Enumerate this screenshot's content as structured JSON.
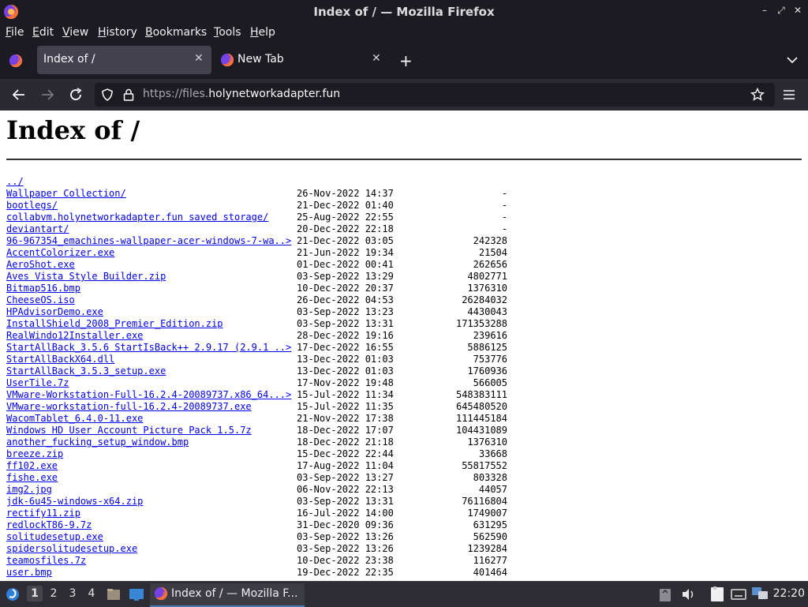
{
  "window": {
    "title": "Index of / — Mozilla Firefox"
  },
  "menubar": {
    "items": [
      {
        "label": "File",
        "accel": "F",
        "rest": "ile"
      },
      {
        "label": "Edit",
        "accel": "E",
        "rest": "dit"
      },
      {
        "label": "View",
        "accel": "V",
        "rest": "iew"
      },
      {
        "label": "History",
        "accel": "H",
        "rest": "istory"
      },
      {
        "label": "Bookmarks",
        "accel": "B",
        "rest": "ookmarks"
      },
      {
        "label": "Tools",
        "accel": "T",
        "rest": "ools"
      },
      {
        "label": "Help",
        "accel": "H",
        "rest": "elp"
      }
    ]
  },
  "tabs": [
    {
      "label": "Index of /",
      "active": true
    },
    {
      "label": "New Tab",
      "active": false
    }
  ],
  "urlbar": {
    "prefix": "https://files.",
    "domain": "holynetworkadapter.fun"
  },
  "page": {
    "heading": "Index of /",
    "parent_link": "../",
    "entries": [
      {
        "name": "Wallpaper Collection/",
        "date": "26-Nov-2022 14:37",
        "size": "-"
      },
      {
        "name": "bootlegs/",
        "date": "21-Dec-2022 01:40",
        "size": "-"
      },
      {
        "name": "collabvm.holynetworkadapter.fun saved storage/",
        "date": "25-Aug-2022 22:55",
        "size": "-"
      },
      {
        "name": "deviantart/",
        "date": "20-Dec-2022 22:18",
        "size": "-"
      },
      {
        "name": "96-967354_emachines-wallpaper-acer-windows-7-wa..>",
        "date": "21-Dec-2022 03:05",
        "size": "242328"
      },
      {
        "name": "AccentColorizer.exe",
        "date": "21-Jun-2022 19:34",
        "size": "21504"
      },
      {
        "name": "AeroShot.exe",
        "date": "01-Dec-2022 00:41",
        "size": "262656"
      },
      {
        "name": "Aves Vista Style Builder.zip",
        "date": "03-Sep-2022 13:29",
        "size": "4802771"
      },
      {
        "name": "Bitmap516.bmp",
        "date": "10-Dec-2022 20:37",
        "size": "1376310"
      },
      {
        "name": "CheeseOS.iso",
        "date": "26-Dec-2022 04:53",
        "size": "26284032"
      },
      {
        "name": "HPAdvisorDemo.exe",
        "date": "03-Sep-2022 13:23",
        "size": "4430043"
      },
      {
        "name": "InstallShield_2008_Premier_Edition.zip",
        "date": "03-Sep-2022 13:31",
        "size": "171353288"
      },
      {
        "name": "RealWindo12Installer.exe",
        "date": "28-Dec-2022 19:16",
        "size": "239616"
      },
      {
        "name": "StartAllBack_3.5.6 StartIsBack++ 2.9.17 (2.9.1 ..>",
        "date": "17-Dec-2022 16:55",
        "size": "5886125"
      },
      {
        "name": "StartAllBackX64.dll",
        "date": "13-Dec-2022 01:03",
        "size": "753776"
      },
      {
        "name": "StartAllBack_3.5.3_setup.exe",
        "date": "13-Dec-2022 01:03",
        "size": "1760936"
      },
      {
        "name": "UserTile.7z",
        "date": "17-Nov-2022 19:48",
        "size": "566005"
      },
      {
        "name": "VMware-Workstation-Full-16.2.4-20089737.x86_64...>",
        "date": "15-Jul-2022 11:34",
        "size": "548383111"
      },
      {
        "name": "VMware-workstation-full-16.2.4-20089737.exe",
        "date": "15-Jul-2022 11:35",
        "size": "645480520"
      },
      {
        "name": "WacomTablet_6.4.0-11.exe",
        "date": "21-Nov-2022 17:38",
        "size": "111445184"
      },
      {
        "name": "Windows HD User Account Picture Pack 1.5.7z",
        "date": "18-Dec-2022 17:07",
        "size": "104431089"
      },
      {
        "name": "another_fucking_setup_window.bmp",
        "date": "18-Dec-2022 21:18",
        "size": "1376310"
      },
      {
        "name": "breeze.zip",
        "date": "15-Dec-2022 22:44",
        "size": "33668"
      },
      {
        "name": "ff102.exe",
        "date": "17-Aug-2022 11:04",
        "size": "55817552"
      },
      {
        "name": "fishe.exe",
        "date": "03-Sep-2022 13:27",
        "size": "803328"
      },
      {
        "name": "img2.jpg",
        "date": "06-Nov-2022 22:13",
        "size": "44057"
      },
      {
        "name": "jdk-6u45-windows-x64.zip",
        "date": "03-Sep-2022 13:31",
        "size": "76116804"
      },
      {
        "name": "rectify11.zip",
        "date": "16-Jul-2022 14:00",
        "size": "1749007"
      },
      {
        "name": "redlockT86-9.7z",
        "date": "31-Dec-2020 09:36",
        "size": "631295"
      },
      {
        "name": "solitudesetup.exe",
        "date": "03-Sep-2022 13:26",
        "size": "562590"
      },
      {
        "name": "spidersolitudesetup.exe",
        "date": "03-Sep-2022 13:26",
        "size": "1239284"
      },
      {
        "name": "teamosfiles.7z",
        "date": "10-Dec-2022 23:38",
        "size": "116277"
      },
      {
        "name": "user.bmp",
        "date": "19-Dec-2022 22:35",
        "size": "401464"
      }
    ]
  },
  "taskbar": {
    "workspaces": [
      "1",
      "2",
      "3",
      "4"
    ],
    "active_workspace": "1",
    "task_label": "Index of / — Mozilla F...",
    "clock": "22:20"
  },
  "colors": {
    "link": "#0000ee",
    "chrome_dark": "#1c1b22",
    "toolbar": "#2b2a33",
    "active_tab": "#42414d"
  }
}
